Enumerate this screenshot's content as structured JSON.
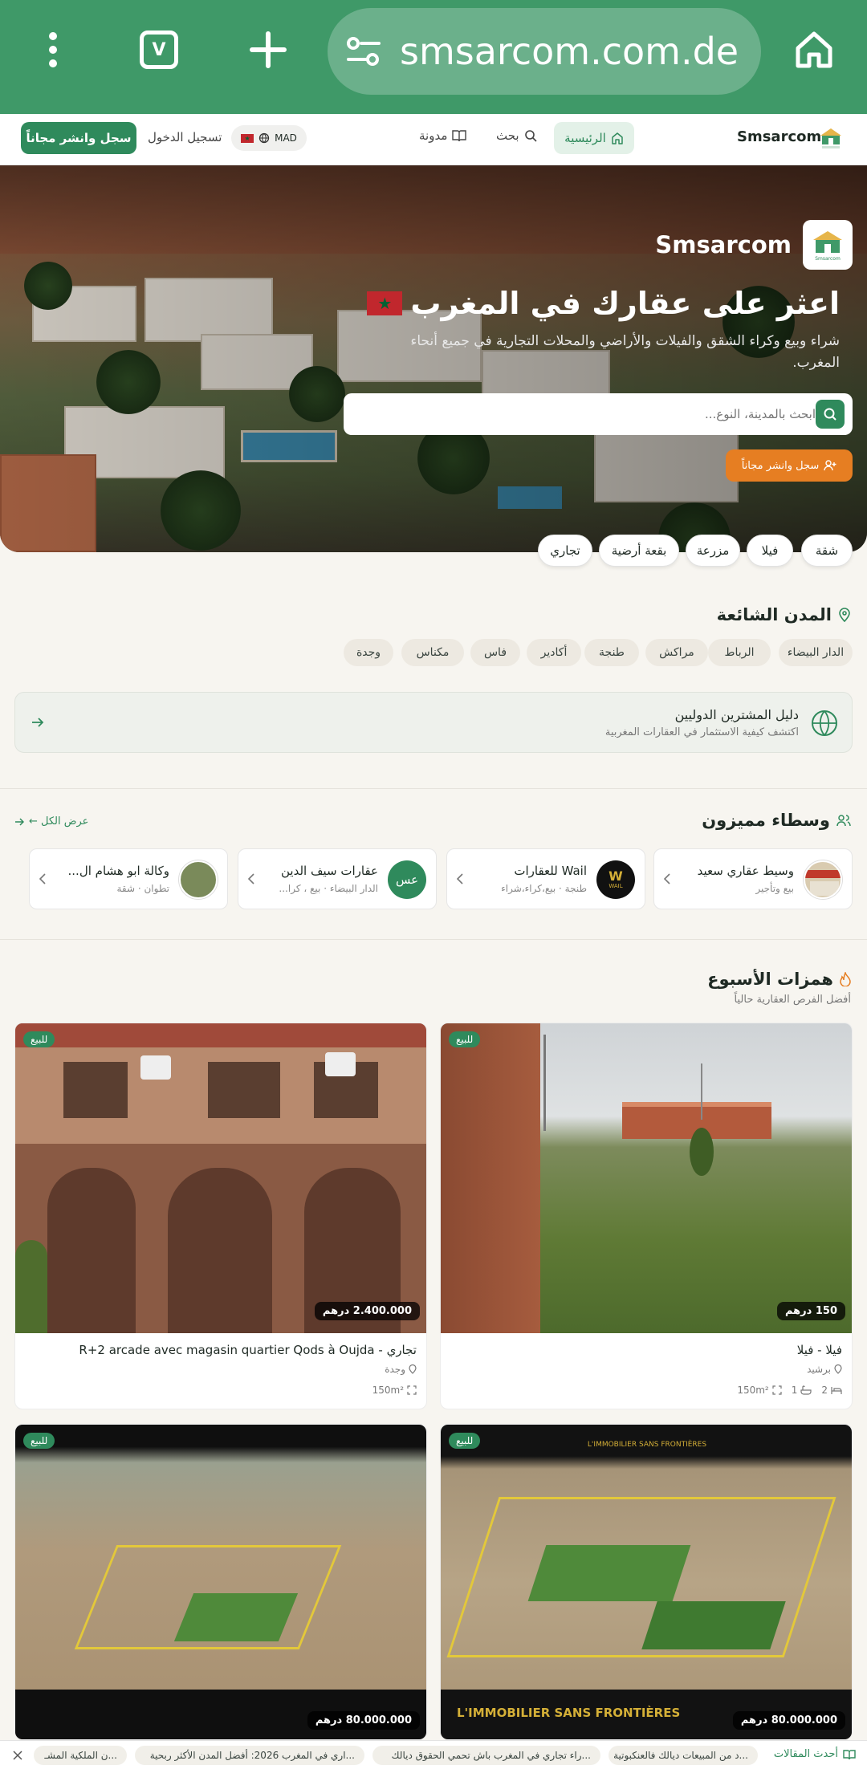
{
  "browser": {
    "url": "smsarcom.com.de",
    "tab_count": "V"
  },
  "nav": {
    "brand": "Smsarcom",
    "home": "الرئيسية",
    "search": "بحث",
    "blog": "مدونة",
    "currency": "MAD",
    "login": "تسجيل الدخول",
    "register": "سجل وانشر مجاناً"
  },
  "hero": {
    "brand": "Smsarcom",
    "logo_caption": "Smsarcom",
    "title": "اعثر على عقارك في المغرب",
    "subtitle": "شراء وبيع وكراء الشقق والفيلات والأراضي والمحلات التجارية في جميع أنحاء المغرب.",
    "search_placeholder": "ابحث بالمدينة، النوع...",
    "cta": "سجل وانشر مجاناً"
  },
  "categories": [
    "شقة",
    "فيلا",
    "مزرعة",
    "بقعة أرضية",
    "تجاري"
  ],
  "popular_cities": {
    "title": "المدن الشائعة",
    "items": [
      "الدار البيضاء",
      "الرباط",
      "مراكش",
      "طنجة",
      "أكادير",
      "فاس",
      "مكناس",
      "وجدة"
    ]
  },
  "buyers_guide": {
    "title": "دليل المشترين الدوليين",
    "subtitle": "اكتشف كيفية الاستثمار في العقارات المغربية"
  },
  "brokers": {
    "title": "وسطاء مميزون",
    "view_all": "عرض الكل ←",
    "items": [
      {
        "name": "وسيط عقاري سعيد",
        "meta": "بيع وتأجير"
      },
      {
        "name": "Wail للعقارات",
        "meta": "طنجة · بيع،كراء،شراء",
        "logo": "WAIL"
      },
      {
        "name": "عقارات سيف الدين",
        "meta": "الدار البيضاء · بيع ، كرا...",
        "initials": "عس"
      },
      {
        "name": "وكالة ابو هشام ال...",
        "meta": "تطوان · شقة"
      }
    ]
  },
  "deals": {
    "title": "همزات الأسبوع",
    "subtitle": "أفضل الفرص العقارية حالياً",
    "items": [
      {
        "badge": "للبيع",
        "price": "150 درهم",
        "title": "فيلا - فيلا",
        "location": "برشيد",
        "area": "150m²",
        "baths": "1",
        "beds": "2"
      },
      {
        "badge": "للبيع",
        "price": "2.400.000 درهم",
        "title": "تجاري - R+2 arcade avec magasin quartier Qods à Oujda",
        "location": "وجدة",
        "area": "150m²"
      },
      {
        "badge": "للبيع",
        "price": "80.000.000 درهم",
        "overlay_top": "L'IMMOBILIER SANS FRONTIÈRES",
        "overlay_bottom": "L'IMMOBILIER SANS FRONTIÈRES"
      },
      {
        "badge": "للبيع",
        "price": "80.000.000 درهم"
      }
    ]
  },
  "ticker": {
    "label": "أحدث المقالات",
    "items": [
      "...د من المبيعات ديالك فالعنكبوتية",
      "...راء تجاري في المغرب باش تحمي الحقوق ديالك",
      "...اري في المغرب 2026: أفضل المدن الأكثر ربحية",
      "...ن الملكية المشـ"
    ]
  },
  "colors": {
    "brand": "#2f8a5c",
    "chrome": "#3f9968",
    "accent_orange": "#e67e22"
  }
}
